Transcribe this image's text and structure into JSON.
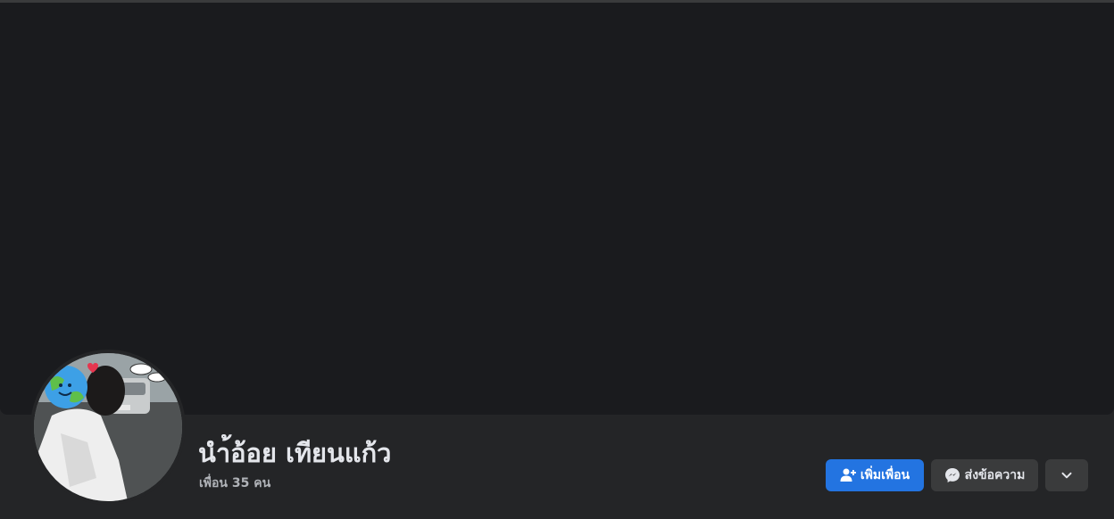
{
  "profile": {
    "name": "นำ้อ้อย เทียนแก้ว",
    "friends_label": "เพื่อน 35 คน"
  },
  "actions": {
    "add_friend_label": "เพิ่มเพื่อน",
    "message_label": "ส่งข้อความ",
    "more_icon": "chevron-down-icon"
  },
  "icons": {
    "add_friend": "person-plus-icon",
    "message": "messenger-icon"
  },
  "colors": {
    "primary_button": "#2374e1",
    "secondary_button": "#3a3b3c",
    "cover_background": "#1a1b1e",
    "header_background": "#242527",
    "name_text": "#e4e6eb",
    "secondary_text": "#b0b3b8"
  }
}
